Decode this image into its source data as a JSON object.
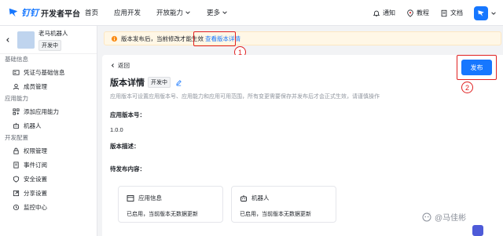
{
  "nav": {
    "brand": "钉钉",
    "title": "开发者平台",
    "items": [
      {
        "label": "首页",
        "has_menu": false
      },
      {
        "label": "应用开发",
        "has_menu": false
      },
      {
        "label": "开放能力",
        "has_menu": true
      },
      {
        "label": "更多",
        "has_menu": true
      }
    ],
    "right": {
      "notify": "通知",
      "tutorial": "教程",
      "docs": "文档"
    }
  },
  "sidebar": {
    "app_name": "老马机器人",
    "app_status": "开发中",
    "sections": [
      {
        "title": "基础信息",
        "items": [
          {
            "label": "凭证与基础信息",
            "icon": "id-card-icon"
          },
          {
            "label": "成员管理",
            "icon": "user-icon"
          }
        ]
      },
      {
        "title": "应用能力",
        "items": [
          {
            "label": "添加应用能力",
            "icon": "grid-add-icon"
          },
          {
            "label": "机器人",
            "icon": "robot-icon"
          }
        ]
      },
      {
        "title": "开发配置",
        "items": [
          {
            "label": "权限管理",
            "icon": "lock-icon"
          },
          {
            "label": "事件订阅",
            "icon": "doc-icon"
          },
          {
            "label": "安全设置",
            "icon": "shield-icon"
          },
          {
            "label": "分享设置",
            "icon": "share-icon"
          },
          {
            "label": "监控中心",
            "icon": "monitor-icon"
          }
        ]
      }
    ]
  },
  "banner": {
    "text": "版本发布后，当前修改才能生效",
    "link": "查看版本详情"
  },
  "main": {
    "back": "返回",
    "title": "版本详情",
    "status": "开发中",
    "description": "应用版本可设置应用版本号、应用能力和应用可用范围，所有变更需要保存并发布后才会正式生效，请谨慎操作",
    "publish": "发布",
    "version_label": "应用版本号：",
    "version_value": "1.0.0",
    "desc_label": "版本描述：",
    "pending_label": "待发布内容：",
    "cards": [
      {
        "title": "应用信息",
        "status": "已启用，当前版本无数据更新",
        "icon": "app-info-icon"
      },
      {
        "title": "机器人",
        "status": "已启用，当前版本无数据更新",
        "icon": "robot-icon"
      }
    ]
  },
  "annotations": {
    "one": "1",
    "two": "2"
  },
  "watermark": "@马佳彬"
}
